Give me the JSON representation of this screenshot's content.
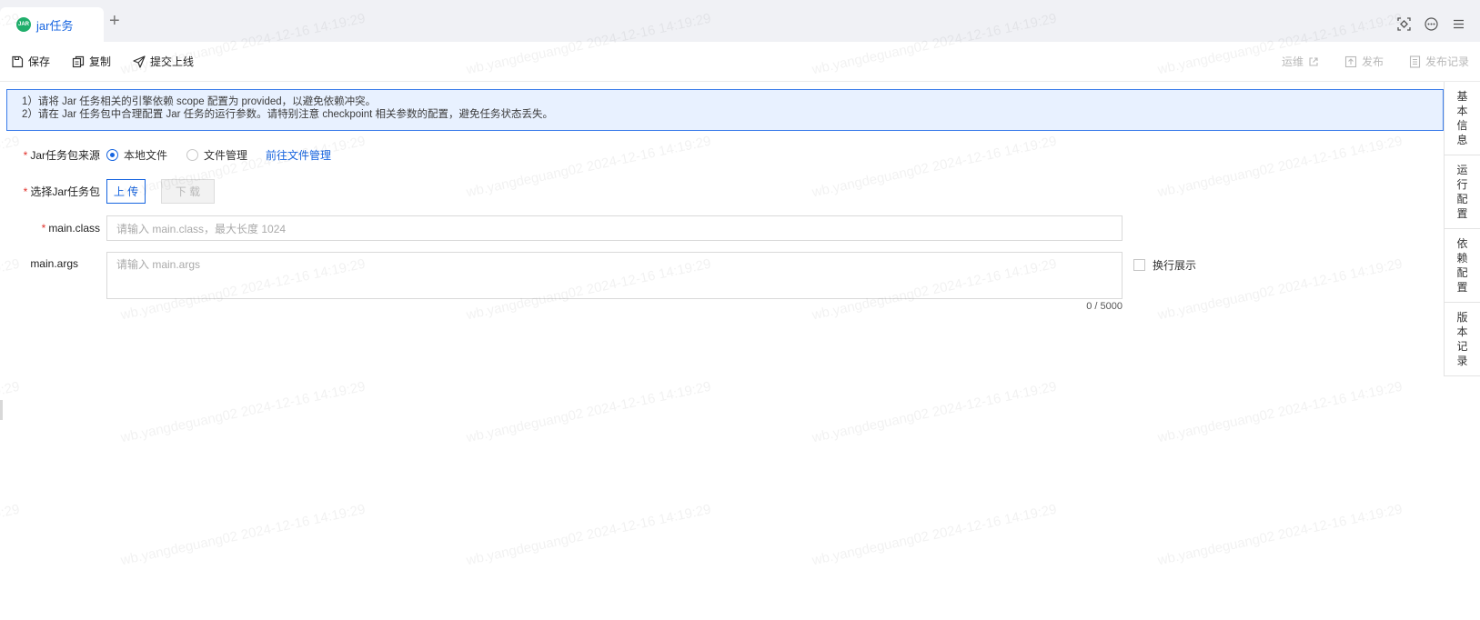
{
  "tab": {
    "icon_text": "JAR",
    "label": "jar任务"
  },
  "toolbar": {
    "save": "保存",
    "copy": "复制",
    "submit": "提交上线",
    "ops": "运维",
    "publish": "发布",
    "publish_log": "发布记录"
  },
  "notice": {
    "line1": "1）请将 Jar 任务相关的引擎依赖 scope 配置为 provided，以避免依赖冲突。",
    "line2": "2）请在 Jar 任务包中合理配置 Jar 任务的运行参数。请特别注意 checkpoint 相关参数的配置，避免任务状态丢失。"
  },
  "sidenav": [
    {
      "chars": [
        "基",
        "本",
        "信",
        "息"
      ]
    },
    {
      "chars": [
        "运",
        "行",
        "配",
        "置"
      ]
    },
    {
      "chars": [
        "依",
        "赖",
        "配",
        "置"
      ]
    },
    {
      "chars": [
        "版",
        "本",
        "记",
        "录"
      ]
    }
  ],
  "form": {
    "source_label": "Jar任务包来源",
    "source_options": [
      "本地文件",
      "文件管理"
    ],
    "source_selected": "本地文件",
    "goto_file_mgmt": "前往文件管理",
    "pkg_label": "选择Jar任务包",
    "upload": "上 传",
    "download": "下 载",
    "main_class_label": "main.class",
    "main_class_placeholder": "请输入 main.class，最大长度 1024",
    "main_args_label": "main.args",
    "main_args_placeholder": "请输入 main.args",
    "counter": "0 / 5000",
    "wrap_display": "换行展示"
  },
  "watermark": "wb.yangdeguang02 2024-12-16 14:19:29",
  "colors": {
    "primary": "#1765e0",
    "required": "#e0302a",
    "notice_bg": "#e8f1ff"
  }
}
